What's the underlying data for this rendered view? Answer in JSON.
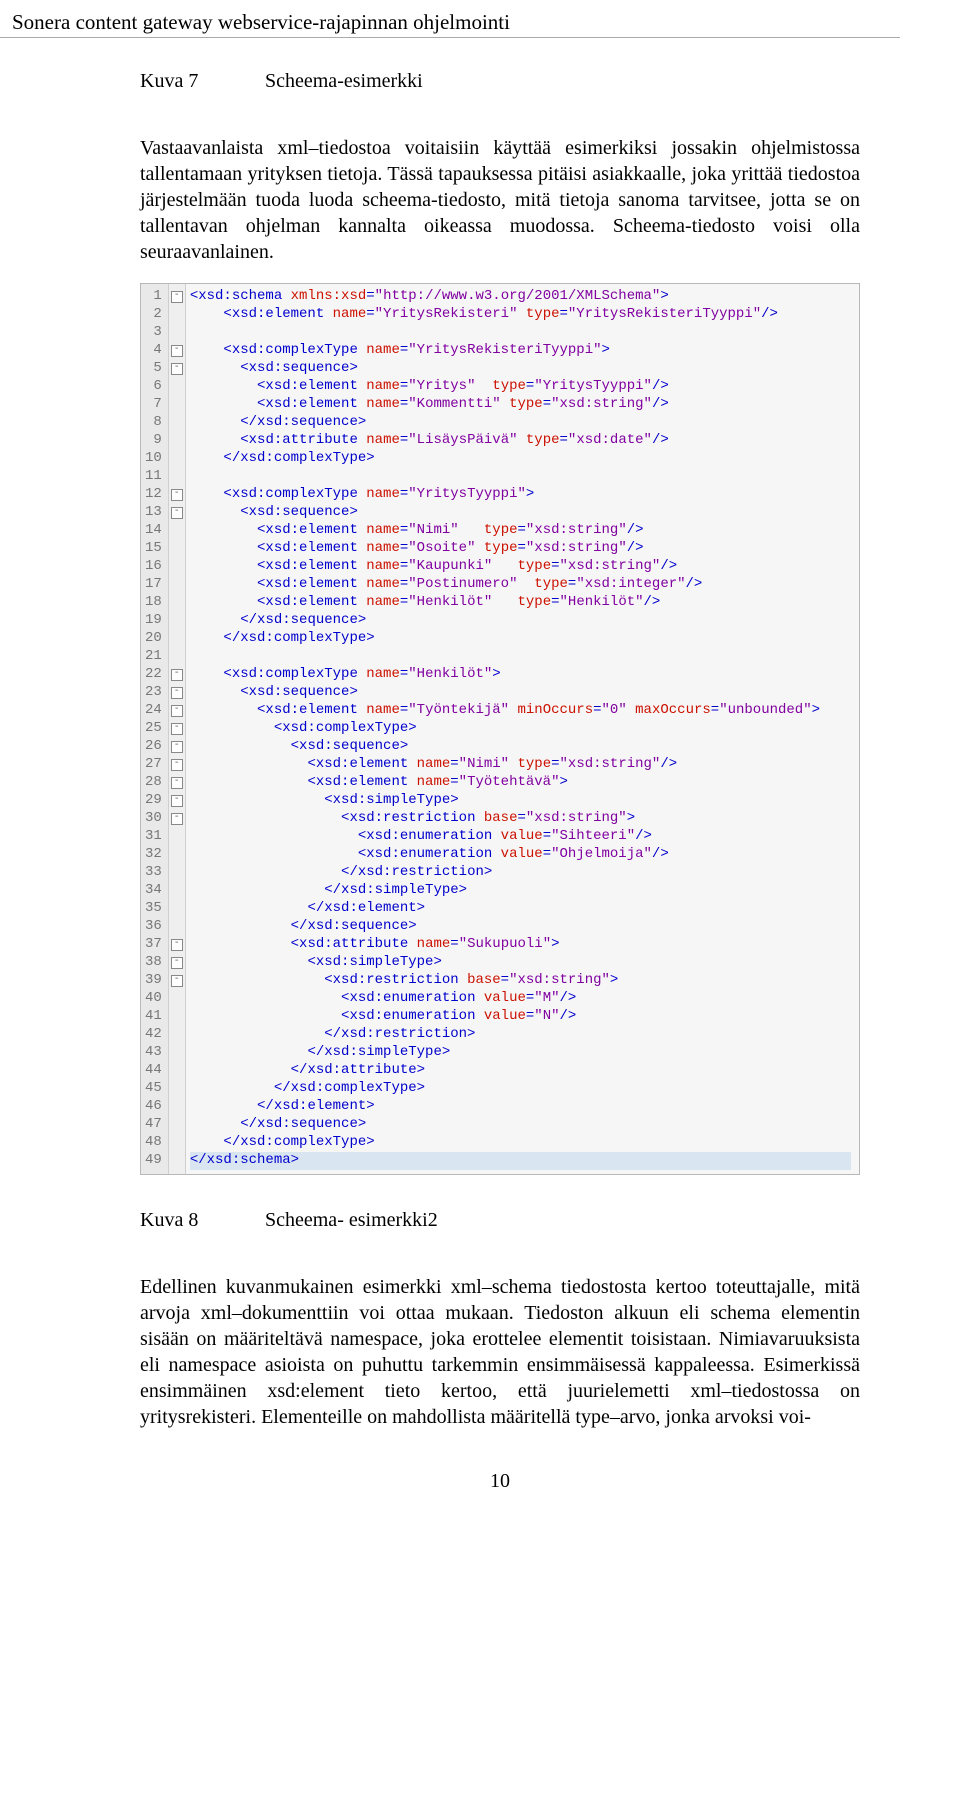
{
  "running_head": "Sonera content gateway webservice-rajapinnan ohjelmointi",
  "fig7": {
    "num": "Kuva 7",
    "title": "Scheema-esimerkki"
  },
  "para1": "Vastaavanlaista xml–tiedostoa voitaisiin käyttää esimerkiksi jossakin ohjelmistossa tallentamaan yrityksen tietoja. Tässä tapauksessa pitäisi asiakkaalle, joka yrittää tiedostoa järjestelmään tuoda luoda scheema-tiedosto, mitä tietoja sanoma tarvitsee, jotta se on tallentavan ohjelman kannalta oikeassa muodossa. Scheema-tiedosto voisi olla seuraavanlainen.",
  "fig8": {
    "num": "Kuva 8",
    "title": "Scheema- esimerkki2"
  },
  "para2": "Edellinen kuvanmukainen esimerkki xml–schema tiedostosta kertoo toteuttajalle, mitä arvoja xml–dokumenttiin voi ottaa mukaan. Tiedoston alkuun eli schema elementin sisään on määriteltävä namespace, joka erottelee elementit toisistaan. Nimiavaruuksista eli namespace asioista on puhuttu tarkemmin ensimmäisessä kappaleessa. Esimerkissä ensimmäinen xsd:element tieto kertoo, että juurielemetti xml–tiedostossa on yritysrekisteri. Elementeille on mahdollista määritellä type–arvo, jonka arvoksi voi-",
  "page_number": "10",
  "code": {
    "fold_lines": [
      1,
      4,
      5,
      12,
      13,
      22,
      23,
      24,
      25,
      26,
      27,
      28,
      29,
      30,
      37,
      38,
      39
    ],
    "lines": [
      [
        [
          0,
          "<xsd:schema "
        ],
        [
          2,
          "xmlns:xsd"
        ],
        [
          0,
          "="
        ],
        [
          3,
          "\"http://www.w3.org/2001/XMLSchema\""
        ],
        [
          0,
          ">"
        ]
      ],
      [
        [
          1,
          "    "
        ],
        [
          0,
          "<xsd:element "
        ],
        [
          2,
          "name"
        ],
        [
          0,
          "="
        ],
        [
          3,
          "\"YritysRekisteri\""
        ],
        [
          0,
          " "
        ],
        [
          2,
          "type"
        ],
        [
          0,
          "="
        ],
        [
          3,
          "\"YritysRekisteriTyyppi\""
        ],
        [
          0,
          "/>"
        ]
      ],
      [
        [
          1,
          ""
        ]
      ],
      [
        [
          1,
          "    "
        ],
        [
          0,
          "<xsd:complexType "
        ],
        [
          2,
          "name"
        ],
        [
          0,
          "="
        ],
        [
          3,
          "\"YritysRekisteriTyyppi\""
        ],
        [
          0,
          ">"
        ]
      ],
      [
        [
          1,
          "      "
        ],
        [
          0,
          "<xsd:sequence>"
        ]
      ],
      [
        [
          1,
          "        "
        ],
        [
          0,
          "<xsd:element "
        ],
        [
          2,
          "name"
        ],
        [
          0,
          "="
        ],
        [
          3,
          "\"Yritys\""
        ],
        [
          0,
          "  "
        ],
        [
          2,
          "type"
        ],
        [
          0,
          "="
        ],
        [
          3,
          "\"YritysTyyppi\""
        ],
        [
          0,
          "/>"
        ]
      ],
      [
        [
          1,
          "        "
        ],
        [
          0,
          "<xsd:element "
        ],
        [
          2,
          "name"
        ],
        [
          0,
          "="
        ],
        [
          3,
          "\"Kommentti\""
        ],
        [
          0,
          " "
        ],
        [
          2,
          "type"
        ],
        [
          0,
          "="
        ],
        [
          3,
          "\"xsd:string\""
        ],
        [
          0,
          "/>"
        ]
      ],
      [
        [
          1,
          "      "
        ],
        [
          0,
          "</xsd:sequence>"
        ]
      ],
      [
        [
          1,
          "      "
        ],
        [
          0,
          "<xsd:attribute "
        ],
        [
          2,
          "name"
        ],
        [
          0,
          "="
        ],
        [
          3,
          "\"LisäysPäivä\""
        ],
        [
          0,
          " "
        ],
        [
          2,
          "type"
        ],
        [
          0,
          "="
        ],
        [
          3,
          "\"xsd:date\""
        ],
        [
          0,
          "/>"
        ]
      ],
      [
        [
          1,
          "    "
        ],
        [
          0,
          "</xsd:complexType>"
        ]
      ],
      [
        [
          1,
          ""
        ]
      ],
      [
        [
          1,
          "    "
        ],
        [
          0,
          "<xsd:complexType "
        ],
        [
          2,
          "name"
        ],
        [
          0,
          "="
        ],
        [
          3,
          "\"YritysTyyppi\""
        ],
        [
          0,
          ">"
        ]
      ],
      [
        [
          1,
          "      "
        ],
        [
          0,
          "<xsd:sequence>"
        ]
      ],
      [
        [
          1,
          "        "
        ],
        [
          0,
          "<xsd:element "
        ],
        [
          2,
          "name"
        ],
        [
          0,
          "="
        ],
        [
          3,
          "\"Nimi\""
        ],
        [
          0,
          "   "
        ],
        [
          2,
          "type"
        ],
        [
          0,
          "="
        ],
        [
          3,
          "\"xsd:string\""
        ],
        [
          0,
          "/>"
        ]
      ],
      [
        [
          1,
          "        "
        ],
        [
          0,
          "<xsd:element "
        ],
        [
          2,
          "name"
        ],
        [
          0,
          "="
        ],
        [
          3,
          "\"Osoite\""
        ],
        [
          0,
          " "
        ],
        [
          2,
          "type"
        ],
        [
          0,
          "="
        ],
        [
          3,
          "\"xsd:string\""
        ],
        [
          0,
          "/>"
        ]
      ],
      [
        [
          1,
          "        "
        ],
        [
          0,
          "<xsd:element "
        ],
        [
          2,
          "name"
        ],
        [
          0,
          "="
        ],
        [
          3,
          "\"Kaupunki\""
        ],
        [
          0,
          "   "
        ],
        [
          2,
          "type"
        ],
        [
          0,
          "="
        ],
        [
          3,
          "\"xsd:string\""
        ],
        [
          0,
          "/>"
        ]
      ],
      [
        [
          1,
          "        "
        ],
        [
          0,
          "<xsd:element "
        ],
        [
          2,
          "name"
        ],
        [
          0,
          "="
        ],
        [
          3,
          "\"Postinumero\""
        ],
        [
          0,
          "  "
        ],
        [
          2,
          "type"
        ],
        [
          0,
          "="
        ],
        [
          3,
          "\"xsd:integer\""
        ],
        [
          0,
          "/>"
        ]
      ],
      [
        [
          1,
          "        "
        ],
        [
          0,
          "<xsd:element "
        ],
        [
          2,
          "name"
        ],
        [
          0,
          "="
        ],
        [
          3,
          "\"Henkilöt\""
        ],
        [
          0,
          "   "
        ],
        [
          2,
          "type"
        ],
        [
          0,
          "="
        ],
        [
          3,
          "\"Henkilöt\""
        ],
        [
          0,
          "/>"
        ]
      ],
      [
        [
          1,
          "      "
        ],
        [
          0,
          "</xsd:sequence>"
        ]
      ],
      [
        [
          1,
          "    "
        ],
        [
          0,
          "</xsd:complexType>"
        ]
      ],
      [
        [
          1,
          ""
        ]
      ],
      [
        [
          1,
          "    "
        ],
        [
          0,
          "<xsd:complexType "
        ],
        [
          2,
          "name"
        ],
        [
          0,
          "="
        ],
        [
          3,
          "\"Henkilöt\""
        ],
        [
          0,
          ">"
        ]
      ],
      [
        [
          1,
          "      "
        ],
        [
          0,
          "<xsd:sequence>"
        ]
      ],
      [
        [
          1,
          "        "
        ],
        [
          0,
          "<xsd:element "
        ],
        [
          2,
          "name"
        ],
        [
          0,
          "="
        ],
        [
          3,
          "\"Työntekijä\""
        ],
        [
          0,
          " "
        ],
        [
          2,
          "minOccurs"
        ],
        [
          0,
          "="
        ],
        [
          3,
          "\"0\""
        ],
        [
          0,
          " "
        ],
        [
          2,
          "maxOccurs"
        ],
        [
          0,
          "="
        ],
        [
          3,
          "\"unbounded\""
        ],
        [
          0,
          ">"
        ]
      ],
      [
        [
          1,
          "          "
        ],
        [
          0,
          "<xsd:complexType>"
        ]
      ],
      [
        [
          1,
          "            "
        ],
        [
          0,
          "<xsd:sequence>"
        ]
      ],
      [
        [
          1,
          "              "
        ],
        [
          0,
          "<xsd:element "
        ],
        [
          2,
          "name"
        ],
        [
          0,
          "="
        ],
        [
          3,
          "\"Nimi\""
        ],
        [
          0,
          " "
        ],
        [
          2,
          "type"
        ],
        [
          0,
          "="
        ],
        [
          3,
          "\"xsd:string\""
        ],
        [
          0,
          "/>"
        ]
      ],
      [
        [
          1,
          "              "
        ],
        [
          0,
          "<xsd:element "
        ],
        [
          2,
          "name"
        ],
        [
          0,
          "="
        ],
        [
          3,
          "\"Työtehtävä\""
        ],
        [
          0,
          ">"
        ]
      ],
      [
        [
          1,
          "                "
        ],
        [
          0,
          "<xsd:simpleType>"
        ]
      ],
      [
        [
          1,
          "                  "
        ],
        [
          0,
          "<xsd:restriction "
        ],
        [
          2,
          "base"
        ],
        [
          0,
          "="
        ],
        [
          3,
          "\"xsd:string\""
        ],
        [
          0,
          ">"
        ]
      ],
      [
        [
          1,
          "                    "
        ],
        [
          0,
          "<xsd:enumeration "
        ],
        [
          2,
          "value"
        ],
        [
          0,
          "="
        ],
        [
          3,
          "\"Sihteeri\""
        ],
        [
          0,
          "/>"
        ]
      ],
      [
        [
          1,
          "                    "
        ],
        [
          0,
          "<xsd:enumeration "
        ],
        [
          2,
          "value"
        ],
        [
          0,
          "="
        ],
        [
          3,
          "\"Ohjelmoija\""
        ],
        [
          0,
          "/>"
        ]
      ],
      [
        [
          1,
          "                  "
        ],
        [
          0,
          "</xsd:restriction>"
        ]
      ],
      [
        [
          1,
          "                "
        ],
        [
          0,
          "</xsd:simpleType>"
        ]
      ],
      [
        [
          1,
          "              "
        ],
        [
          0,
          "</xsd:element>"
        ]
      ],
      [
        [
          1,
          "            "
        ],
        [
          0,
          "</xsd:sequence>"
        ]
      ],
      [
        [
          1,
          "            "
        ],
        [
          0,
          "<xsd:attribute "
        ],
        [
          2,
          "name"
        ],
        [
          0,
          "="
        ],
        [
          3,
          "\"Sukupuoli\""
        ],
        [
          0,
          ">"
        ]
      ],
      [
        [
          1,
          "              "
        ],
        [
          0,
          "<xsd:simpleType>"
        ]
      ],
      [
        [
          1,
          "                "
        ],
        [
          0,
          "<xsd:restriction "
        ],
        [
          2,
          "base"
        ],
        [
          0,
          "="
        ],
        [
          3,
          "\"xsd:string\""
        ],
        [
          0,
          ">"
        ]
      ],
      [
        [
          1,
          "                  "
        ],
        [
          0,
          "<xsd:enumeration "
        ],
        [
          2,
          "value"
        ],
        [
          0,
          "="
        ],
        [
          3,
          "\"M\""
        ],
        [
          0,
          "/>"
        ]
      ],
      [
        [
          1,
          "                  "
        ],
        [
          0,
          "<xsd:enumeration "
        ],
        [
          2,
          "value"
        ],
        [
          0,
          "="
        ],
        [
          3,
          "\"N\""
        ],
        [
          0,
          "/>"
        ]
      ],
      [
        [
          1,
          "                "
        ],
        [
          0,
          "</xsd:restriction>"
        ]
      ],
      [
        [
          1,
          "              "
        ],
        [
          0,
          "</xsd:simpleType>"
        ]
      ],
      [
        [
          1,
          "            "
        ],
        [
          0,
          "</xsd:attribute>"
        ]
      ],
      [
        [
          1,
          "          "
        ],
        [
          0,
          "</xsd:complexType>"
        ]
      ],
      [
        [
          1,
          "        "
        ],
        [
          0,
          "</xsd:element>"
        ]
      ],
      [
        [
          1,
          "      "
        ],
        [
          0,
          "</xsd:sequence>"
        ]
      ],
      [
        [
          1,
          "    "
        ],
        [
          0,
          "</xsd:complexType>"
        ]
      ],
      [
        [
          0,
          "</xsd:schema>"
        ]
      ]
    ]
  }
}
